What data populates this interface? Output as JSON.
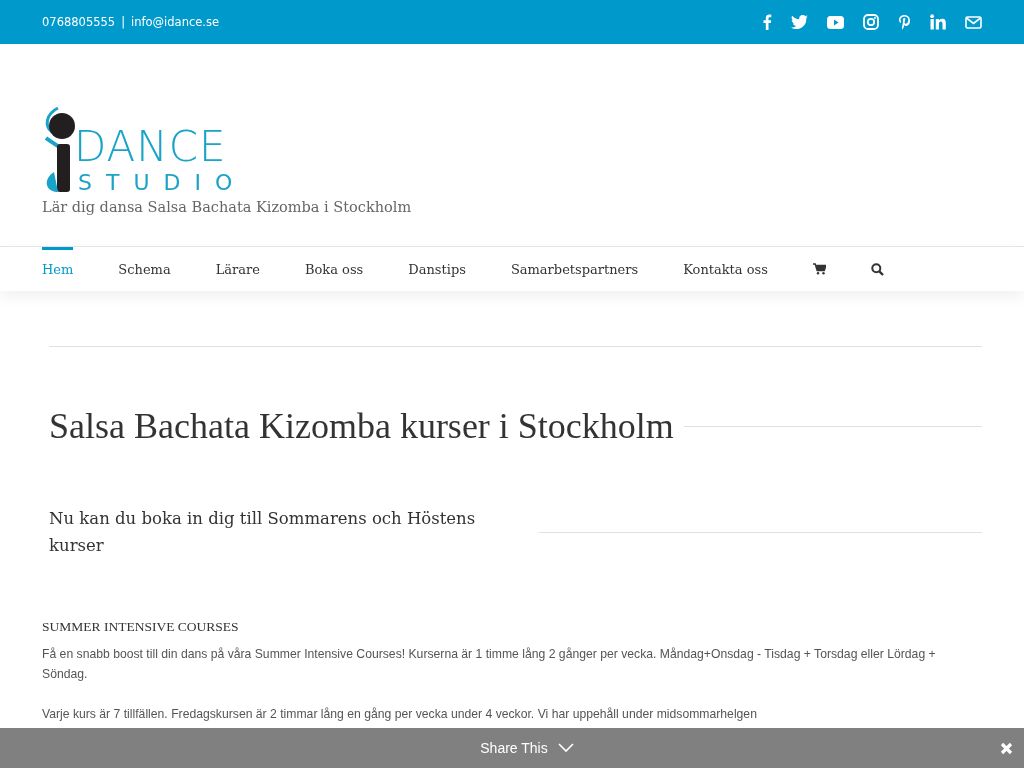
{
  "top_bar": {
    "phone": "0768805555",
    "separator": "|",
    "email": "info@idance.se",
    "social": [
      {
        "kind": "facebook"
      },
      {
        "kind": "twitter"
      },
      {
        "kind": "youtube"
      },
      {
        "kind": "instagram"
      },
      {
        "kind": "pinterest"
      },
      {
        "kind": "linkedin"
      },
      {
        "kind": "email"
      }
    ]
  },
  "logo": {
    "word": "DANCE",
    "subword": "STUDIO"
  },
  "tagline": "Lär dig dansa Salsa Bachata Kizomba i Stockholm",
  "nav": [
    {
      "label": "Hem",
      "selected": true
    },
    {
      "label": "Schema",
      "selected": false
    },
    {
      "label": "Lärare",
      "selected": false
    },
    {
      "label": "Boka oss",
      "selected": false
    },
    {
      "label": "Danstips",
      "selected": false
    },
    {
      "label": "Samarbetspartners",
      "selected": false
    },
    {
      "label": "Kontakta oss",
      "selected": false
    }
  ],
  "page_title": "Salsa Bachata Kizomba kurser i Stockholm",
  "subtitle": "Nu kan du boka in dig till Sommarens och Höstens kurser",
  "section_heading": "SUMMER INTENSIVE COURSES",
  "paragraphs": [
    "Få en snabb boost till din dans på våra Summer Intensive Courses! Kurserna är 1 timme lång 2 gånger per vecka. Måndag+Onsdag  - Tisdag + Torsdag eller Lördag + Söndag.",
    "Varje kurs är 7 tillfällen. Fredagskursen är 2 timmar lång en gång per vecka under 4 veckor. Vi har uppehåll under midsommarhelgen"
  ],
  "share_bar": {
    "label": "Share This"
  }
}
